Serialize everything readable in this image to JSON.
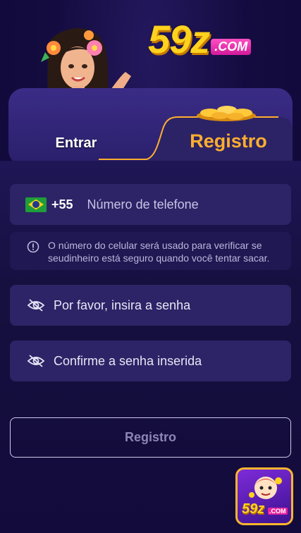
{
  "header": {
    "logo_number": "59z",
    "logo_domain": ".COM",
    "brand_colors": {
      "yellow": "#ffd21e",
      "pink": "#e5239e"
    }
  },
  "tabs": {
    "login_label": "Entrar",
    "register_label": "Registro",
    "active": "register",
    "active_color": "#ffae2e"
  },
  "form": {
    "phone": {
      "flag_icon": "brazil-flag-icon",
      "country_code": "+55",
      "placeholder": "Número de telefone",
      "value": ""
    },
    "notice": {
      "icon": "info-circle-icon",
      "text": "O número do celular será usado para verificar se seudinheiro está seguro quando você tentar sacar."
    },
    "password": {
      "icon": "eye-off-icon",
      "placeholder": "Por favor, insira a senha",
      "value": ""
    },
    "confirm_password": {
      "icon": "eye-off-icon",
      "placeholder": "Confirme a senha inserida",
      "value": ""
    },
    "submit_label": "Registro"
  },
  "floating_badge": {
    "text": "59z",
    "domain": ".COM"
  }
}
